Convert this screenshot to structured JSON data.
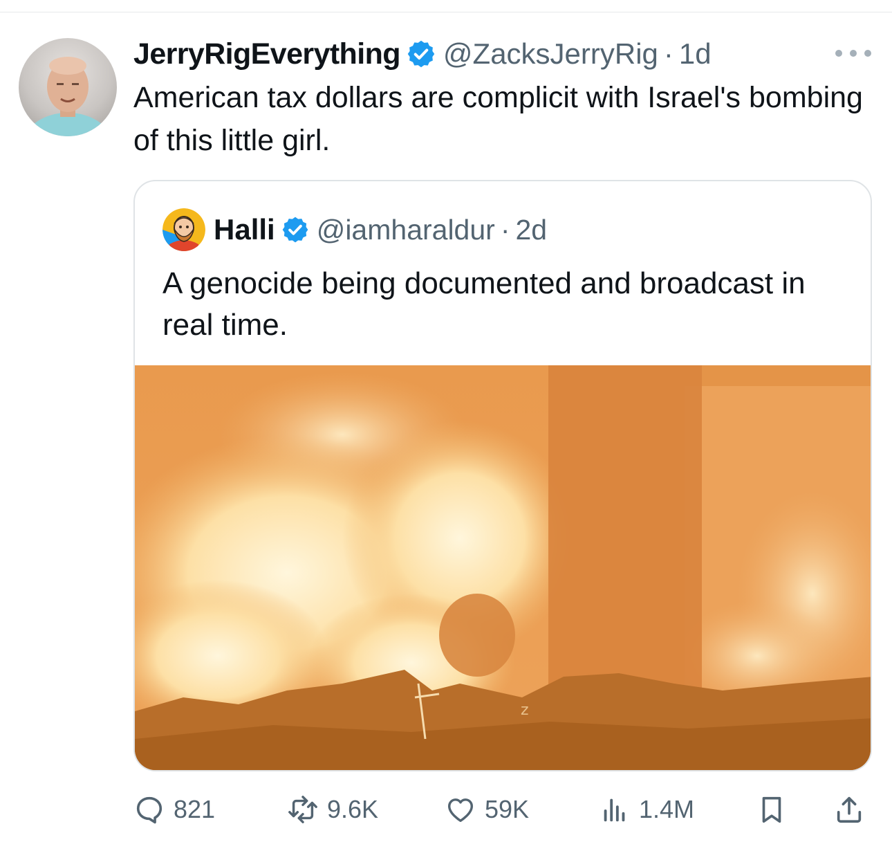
{
  "tweet": {
    "display_name": "JerryRigEverything",
    "handle": "@ZacksJerryRig",
    "separator": "·",
    "time": "1d",
    "text": "American tax dollars are complicit with Israel's bombing of this little girl."
  },
  "quoted_tweet": {
    "display_name": "Halli",
    "handle": "@iamharaldur",
    "separator": "·",
    "time": "2d",
    "text": "A genocide being documented and broadcast in real time."
  },
  "actions": {
    "replies": "821",
    "reposts": "9.6K",
    "likes": "59K",
    "views": "1.4M"
  },
  "icons": {
    "verified": "verified-badge-icon",
    "more": "more-icon",
    "reply": "reply-icon",
    "repost": "repost-icon",
    "like": "like-icon",
    "views": "views-icon",
    "bookmark": "bookmark-icon",
    "share": "share-icon"
  },
  "colors": {
    "verified_blue": "#1d9bf0",
    "secondary_text": "#536471",
    "border": "#dfe3e6"
  }
}
